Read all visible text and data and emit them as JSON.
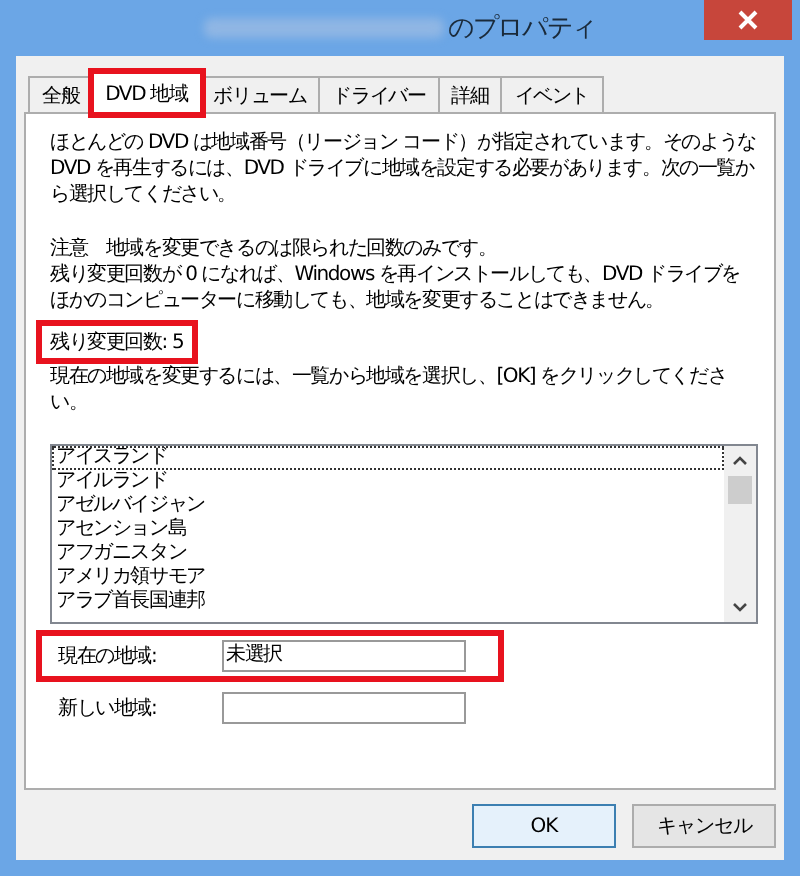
{
  "window": {
    "title": "のプロパティ"
  },
  "tabs": [
    {
      "label": "全般",
      "selected": false,
      "highlighted": false
    },
    {
      "label": "DVD 地域",
      "selected": true,
      "highlighted": true
    },
    {
      "label": "ボリューム",
      "selected": false,
      "highlighted": false
    },
    {
      "label": "ドライバー",
      "selected": false,
      "highlighted": false
    },
    {
      "label": "詳細",
      "selected": false,
      "highlighted": false
    },
    {
      "label": "イベント",
      "selected": false,
      "highlighted": false
    }
  ],
  "intro": "ほとんどの DVD は地域番号（リージョン コード）が指定されています。そのような DVD を再生するには、DVD ドライブに地域を設定する必要があります。次の一覧から選択してください。",
  "notice": [
    "注意　地域を変更できるのは限られた回数のみです。",
    "残り変更回数が 0 になれば、Windows を再インストールしても、DVD ドライブをほかのコンピューターに移動しても、地域を変更することはできません。"
  ],
  "remaining": {
    "text": "残り変更回数: 5",
    "highlighted": true
  },
  "instruction": "現在の地域を変更するには、一覧から地域を選択し、[OK] をクリックしてください。",
  "regions": [
    {
      "label": "アイスランド",
      "focused": true
    },
    {
      "label": "アイルランド",
      "focused": false
    },
    {
      "label": "アゼルバイジャン",
      "focused": false
    },
    {
      "label": "アセンション島",
      "focused": false
    },
    {
      "label": "アフガニスタン",
      "focused": false
    },
    {
      "label": "アメリカ領サモア",
      "focused": false
    },
    {
      "label": "アラブ首長国連邦",
      "focused": false
    }
  ],
  "fields": [
    {
      "label": "現在の地域:",
      "value": "未選択",
      "highlighted": true
    },
    {
      "label": "新しい地域:",
      "highlighted": false
    }
  ],
  "buttons": [
    {
      "label": "OK",
      "default": true
    },
    {
      "label": "キャンセル",
      "default": false
    }
  ]
}
